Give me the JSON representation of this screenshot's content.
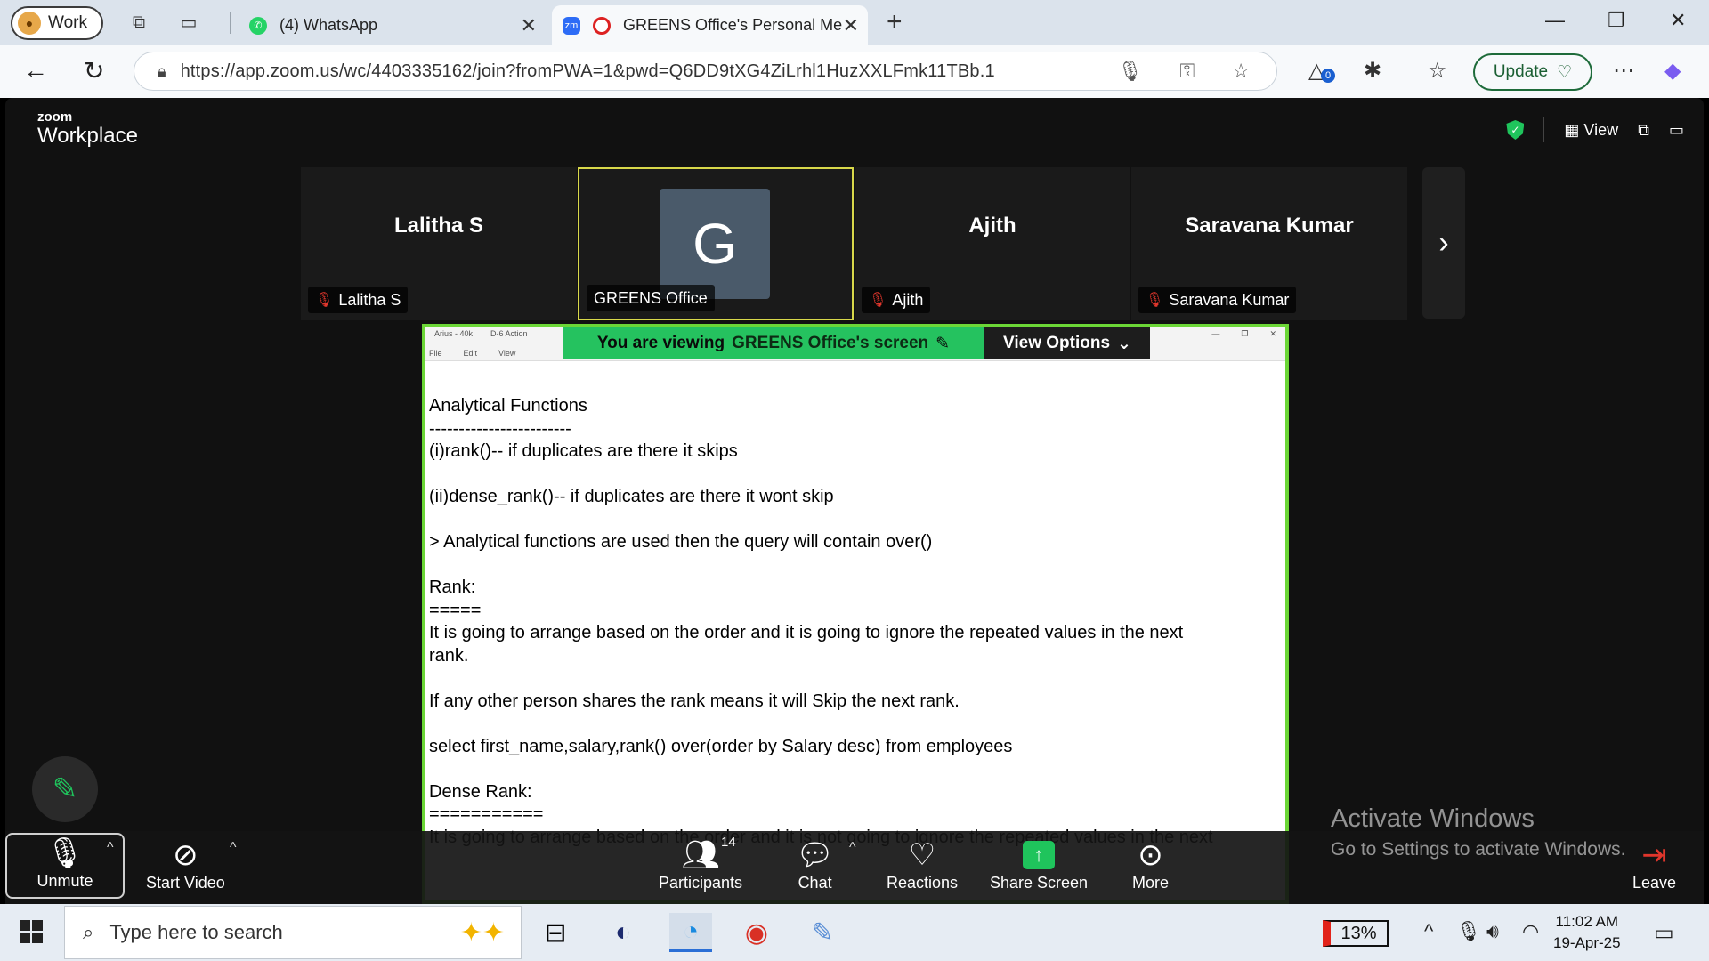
{
  "browser": {
    "profile_label": "Work",
    "tabs": [
      {
        "title": "(4) WhatsApp"
      },
      {
        "title": "GREENS Office's Personal Me"
      }
    ],
    "url": "https://app.zoom.us/wc/4403335162/join?fromPWA=1&pwd=Q6DD9tXG4ZiLrhl1HuzXXLFmk11TBb.1",
    "update_label": "Update",
    "extension_badge": "0"
  },
  "zoom": {
    "brand_small": "zoom",
    "brand_big": "Workplace",
    "view_label": "View",
    "participants_strip": [
      {
        "name": "Lalitha S",
        "tag": "Lalitha S",
        "muted": true
      },
      {
        "name": "G",
        "tag": "GREENS Office",
        "muted": false,
        "active": true
      },
      {
        "name": "Ajith",
        "tag": "Ajith",
        "muted": true
      },
      {
        "name": "Saravana Kumar",
        "tag": "Saravana Kumar",
        "muted": true
      }
    ],
    "share_banner": {
      "prefix": "You are viewing",
      "owner": "GREENS Office's screen",
      "view_options": "View Options"
    },
    "shared_window": {
      "tabs": [
        "Arius - 40k",
        "D-6 Action"
      ],
      "menu": [
        "File",
        "Edit",
        "View"
      ]
    },
    "document_lines": [
      "Analytical Functions",
      "------------------------",
      "(i)rank()-- if duplicates are there it skips",
      "",
      "(ii)dense_rank()-- if duplicates are there it wont skip",
      "",
      "> Analytical functions are used then the query will contain over()",
      "",
      "Rank:",
      "=====",
      "It is going to arrange based on the order and it is going to ignore the repeated values in the next",
      "rank.",
      "",
      "If any other person shares the rank means it will Skip the next rank.",
      "",
      "select first_name,salary,rank() over(order by Salary desc) from employees",
      "",
      "Dense Rank:",
      "===========",
      "It is going to arrange based on the order and it is not going to ignore the repeated values in the next"
    ],
    "toolbar": {
      "unmute": "Unmute",
      "start_video": "Start Video",
      "participants": "Participants",
      "participants_count": "14",
      "chat": "Chat",
      "reactions": "Reactions",
      "share_screen": "Share Screen",
      "more": "More",
      "leave": "Leave"
    },
    "watermark": {
      "line1": "Activate Windows",
      "line2": "Go to Settings to activate Windows."
    }
  },
  "taskbar": {
    "search_placeholder": "Type here to search",
    "battery": "13%",
    "time": "11:02 AM",
    "date": "19-Apr-25"
  }
}
